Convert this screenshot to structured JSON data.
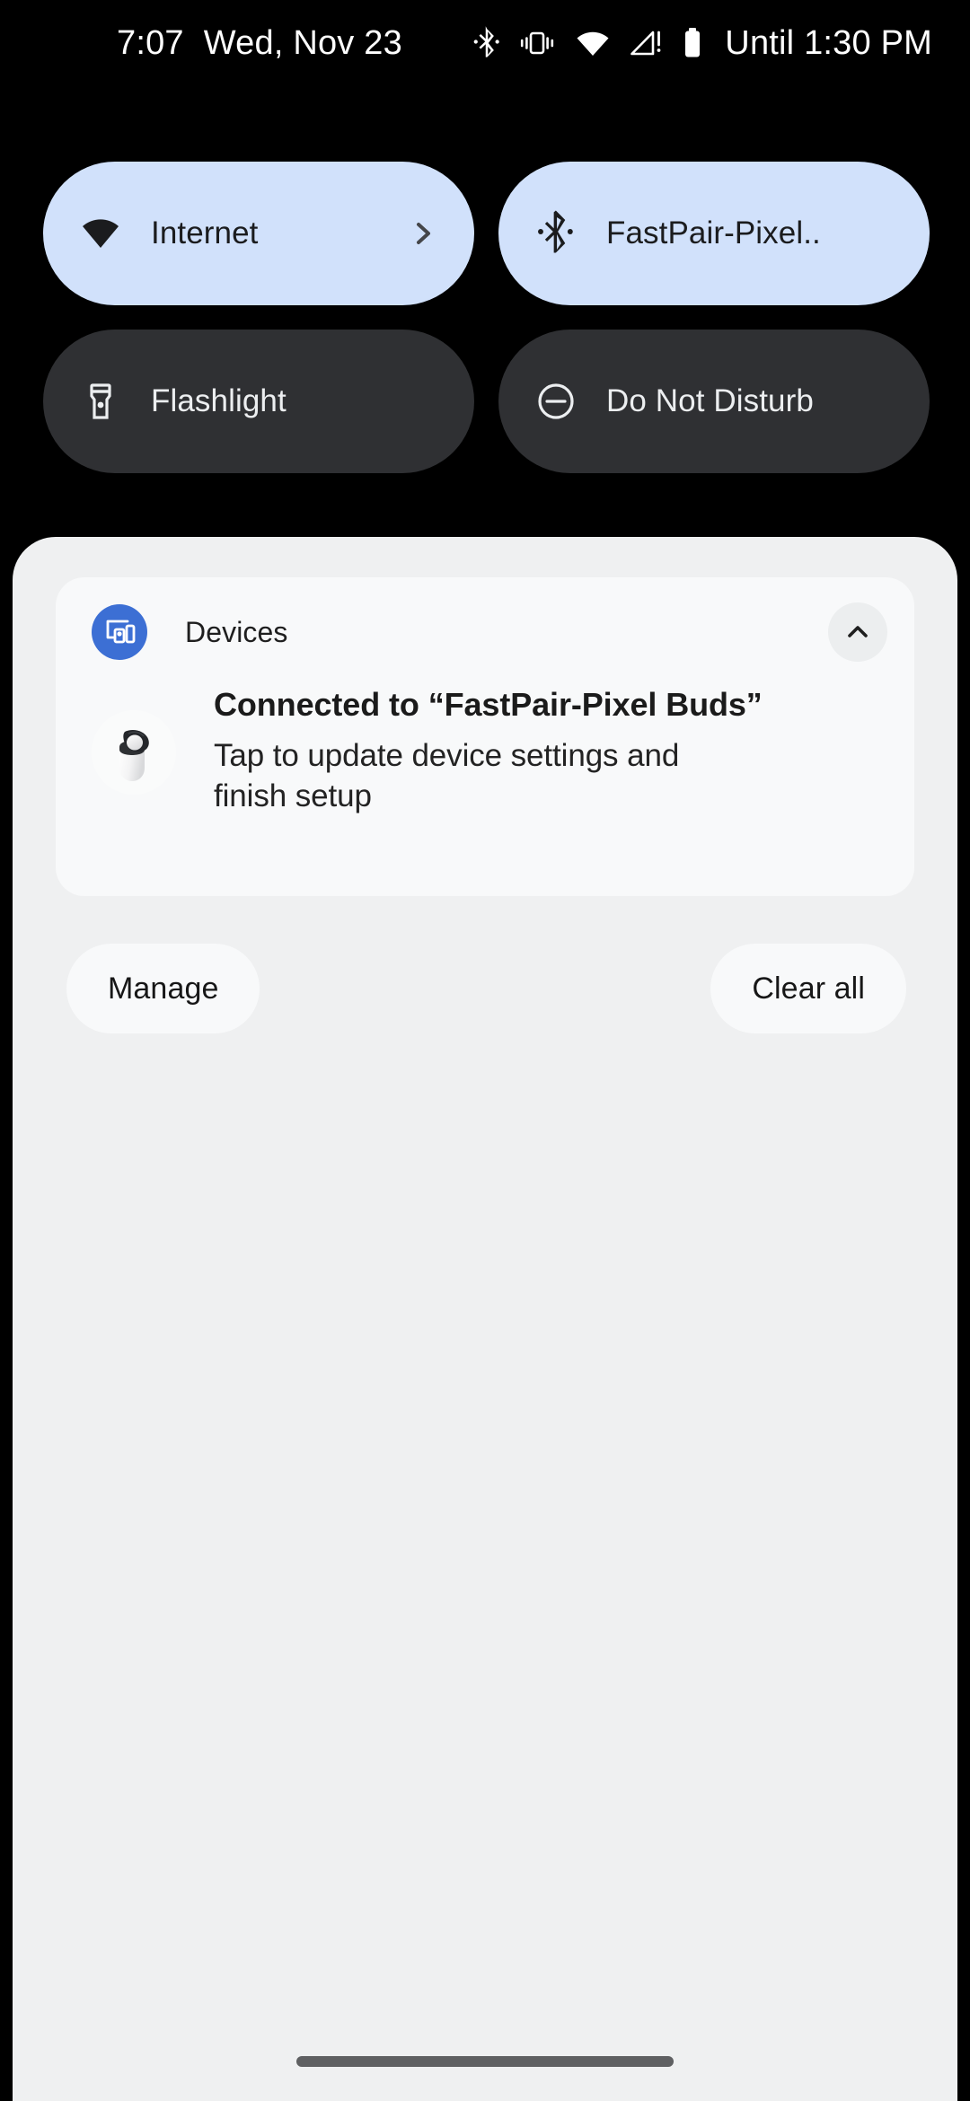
{
  "status_bar": {
    "time": "7:07",
    "date": "Wed, Nov 23",
    "icons": [
      "bluetooth-icon",
      "vibrate-icon",
      "wifi-icon",
      "cell-signal-alert-icon",
      "battery-icon"
    ],
    "dnd_until": "Until 1:30 PM"
  },
  "quick_settings": {
    "tiles": [
      {
        "label": "Internet",
        "icon": "wifi-icon",
        "state": "on",
        "has_chevron": true
      },
      {
        "label": "FastPair-Pixel..",
        "icon": "bluetooth-icon",
        "state": "on",
        "has_chevron": false
      },
      {
        "label": "Flashlight",
        "icon": "flashlight-icon",
        "state": "off",
        "has_chevron": false
      },
      {
        "label": "Do Not Disturb",
        "icon": "do-not-disturb-icon",
        "state": "off",
        "has_chevron": false
      }
    ]
  },
  "notification": {
    "app_name": "Devices",
    "app_icon": "devices-icon",
    "collapse_icon": "chevron-up-icon",
    "thumbnail": "pixel-buds-case-image",
    "title": "Connected to “FastPair-Pixel Buds”",
    "text_line_1": "Tap to update device settings and",
    "text_line_2": "finish setup"
  },
  "shade_actions": {
    "manage": "Manage",
    "clear_all": "Clear all"
  },
  "colors": {
    "tile_on_bg": "#d1e1fb",
    "tile_off_bg": "#2f3033",
    "shade_bg": "#eff0f1",
    "card_bg": "#f8f9fa",
    "app_icon_bg": "#3c6fd4",
    "status_bar_bg": "#000000"
  }
}
